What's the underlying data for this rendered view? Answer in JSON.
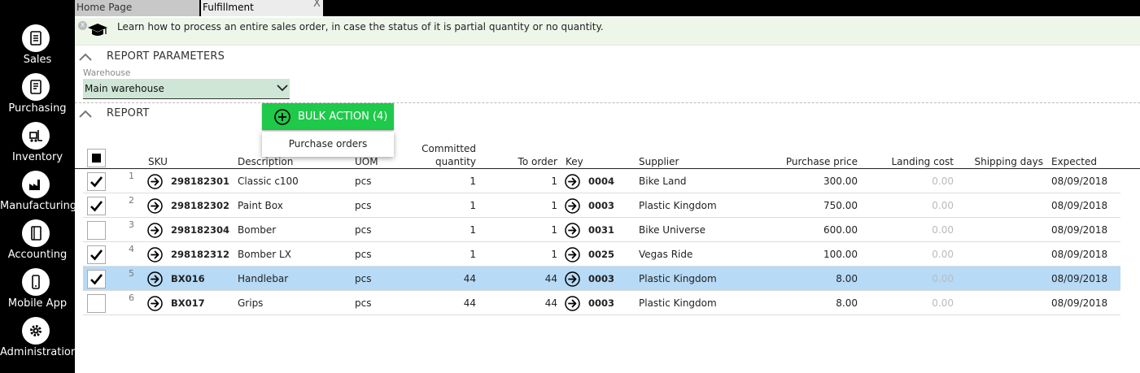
{
  "sidebar": {
    "items": [
      {
        "label": "Sales",
        "icon": "receipt-icon"
      },
      {
        "label": "Purchasing",
        "icon": "purchase-list-icon"
      },
      {
        "label": "Inventory",
        "icon": "forklift-icon"
      },
      {
        "label": "Manufacturing",
        "icon": "factory-icon"
      },
      {
        "label": "Accounting",
        "icon": "ledger-icon"
      },
      {
        "label": "Mobile App",
        "icon": "mobile-icon"
      },
      {
        "label": "Administration",
        "icon": "gear-icon"
      }
    ]
  },
  "tabs": [
    {
      "label": "Home Page"
    },
    {
      "label": "Fulfillment",
      "active": true,
      "close": "X"
    }
  ],
  "banner": {
    "close": "x",
    "text": "Learn how to process an entire sales order, in case the status of it is partial quantity or no quantity."
  },
  "report_parameters": {
    "title": "REPORT PARAMETERS",
    "warehouse_label": "Warehouse",
    "warehouse_value": "Main warehouse"
  },
  "report": {
    "title": "REPORT",
    "bulk_action_label": "BULK ACTION (4)",
    "dropdown_item": "Purchase orders"
  },
  "table": {
    "headers": {
      "sku": "SKU",
      "description": "Description",
      "uom": "UOM",
      "committed_line1": "Committed",
      "committed_line2": "quantity",
      "to_order": "To order",
      "key": "Key",
      "supplier": "Supplier",
      "purchase_price": "Purchase price",
      "landing_cost": "Landing cost",
      "shipping_days": "Shipping days",
      "expected": "Expected"
    },
    "rows": [
      {
        "num": "1",
        "checked": true,
        "sku": "298182301",
        "description": "Classic c100",
        "uom": "pcs",
        "committed": "1",
        "to_order": "1",
        "key": "0004",
        "supplier": "Bike Land",
        "purchase_price": "300.00",
        "landing_cost": "0.00",
        "expected": "08/09/2018",
        "selected": false
      },
      {
        "num": "2",
        "checked": true,
        "sku": "298182302",
        "description": "Paint Box",
        "uom": "pcs",
        "committed": "1",
        "to_order": "1",
        "key": "0003",
        "supplier": "Plastic Kingdom",
        "purchase_price": "750.00",
        "landing_cost": "0.00",
        "expected": "08/09/2018",
        "selected": false
      },
      {
        "num": "3",
        "checked": false,
        "sku": "298182304",
        "description": "Bomber",
        "uom": "pcs",
        "committed": "1",
        "to_order": "1",
        "key": "0031",
        "supplier": "Bike Universe",
        "purchase_price": "600.00",
        "landing_cost": "0.00",
        "expected": "08/09/2018",
        "selected": false
      },
      {
        "num": "4",
        "checked": true,
        "sku": "298182312",
        "description": "Bomber LX",
        "uom": "pcs",
        "committed": "1",
        "to_order": "1",
        "key": "0025",
        "supplier": "Vegas Ride",
        "purchase_price": "100.00",
        "landing_cost": "0.00",
        "expected": "08/09/2018",
        "selected": false
      },
      {
        "num": "5",
        "checked": true,
        "sku": "BX016",
        "description": "Handlebar",
        "uom": "pcs",
        "committed": "44",
        "to_order": "44",
        "key": "0003",
        "supplier": "Plastic Kingdom",
        "purchase_price": "8.00",
        "landing_cost": "0.00",
        "expected": "08/09/2018",
        "selected": true
      },
      {
        "num": "6",
        "checked": false,
        "sku": "BX017",
        "description": "Grips",
        "uom": "pcs",
        "committed": "44",
        "to_order": "44",
        "key": "0003",
        "supplier": "Plastic Kingdom",
        "purchase_price": "8.00",
        "landing_cost": "0.00",
        "expected": "08/09/2018",
        "selected": false
      }
    ]
  },
  "colors": {
    "sidebar": "#000000",
    "accent_green": "#1fc94a",
    "selected_row": "#b7daf6",
    "warehouse_field": "#cfe6d6",
    "banner": "#eef6ea"
  }
}
